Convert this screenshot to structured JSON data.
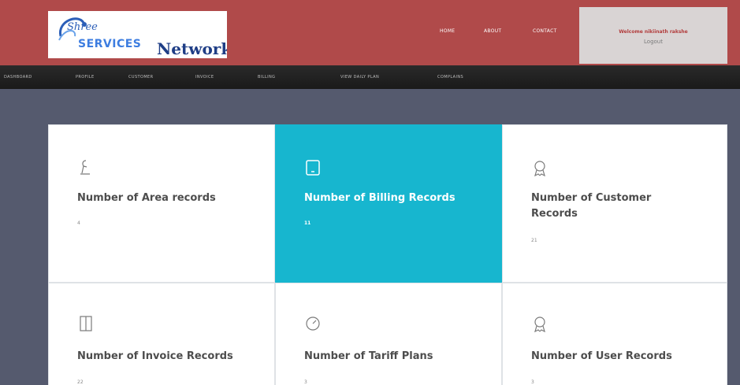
{
  "header": {
    "logo": {
      "line1": "Shree",
      "line2": "SERVICES",
      "line3": "Network"
    },
    "nav": [
      "HOME",
      "ABOUT",
      "CONTACT"
    ],
    "welcome": "Welcome nikiinath rakshe",
    "logout": "Logout"
  },
  "menu": [
    "DASHBOARD",
    "PROFILE",
    "CUSTOMER",
    "INVOICE",
    "BILLING",
    "VIEW DAILY PLAN",
    "COMPLAINS"
  ],
  "cards": [
    {
      "title": "Number of Area records",
      "count": "4",
      "icon": "pin-icon"
    },
    {
      "title": "Number of Billing Records",
      "count": "11",
      "icon": "tablet-icon"
    },
    {
      "title": "Number of Customer Records",
      "count": "21",
      "icon": "award-icon"
    },
    {
      "title": "Number of Invoice Records",
      "count": "22",
      "icon": "door-icon"
    },
    {
      "title": "Number of Tariff Plans",
      "count": "3",
      "icon": "gauge-icon"
    },
    {
      "title": "Number of User Records",
      "count": "3",
      "icon": "award-icon"
    }
  ],
  "colors": {
    "header": "#b04a4a",
    "accent": "#17b6cf",
    "background": "#555a6e"
  }
}
